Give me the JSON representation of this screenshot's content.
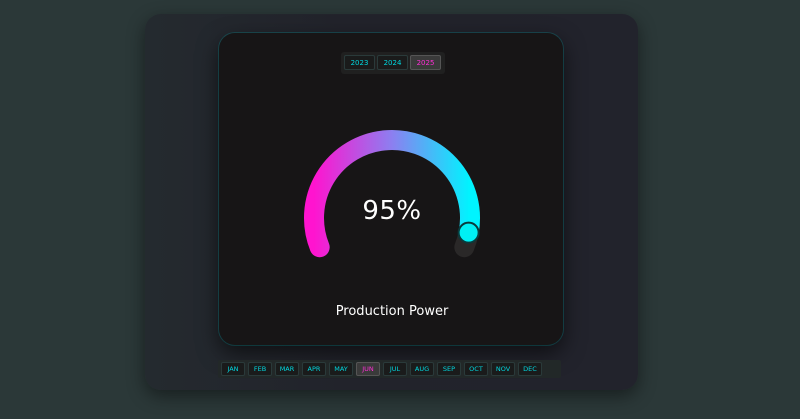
{
  "years": {
    "options": [
      "2023",
      "2024",
      "2025"
    ],
    "selected": "2025"
  },
  "gauge": {
    "value_text": "95%",
    "value": 0.95,
    "title": "Production Power",
    "colors": {
      "start": "#ff14cf",
      "end": "#00f4ff",
      "track": "#2a2828",
      "knob": "#00f0f4"
    }
  },
  "months": {
    "options": [
      "JAN",
      "FEB",
      "MAR",
      "APR",
      "MAY",
      "JUN",
      "JUL",
      "AUG",
      "SEP",
      "OCT",
      "NOV",
      "DEC"
    ],
    "selected": "JUN"
  }
}
